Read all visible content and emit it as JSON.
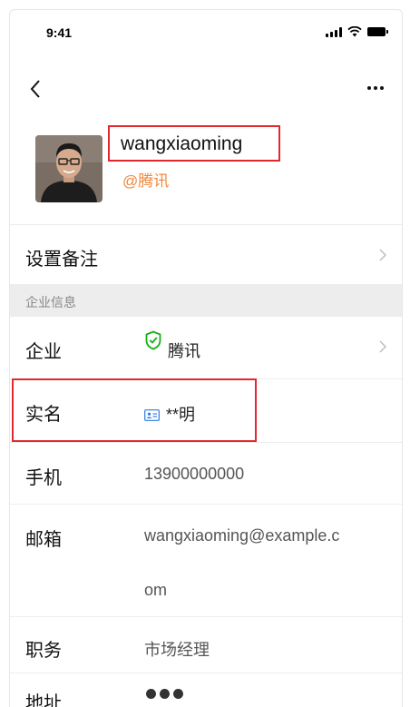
{
  "status_bar": {
    "time": "9:41",
    "icons": [
      "signal-icon",
      "wifi-icon",
      "battery-icon"
    ]
  },
  "nav": {
    "back_icon": "chevron-left-icon",
    "more_icon": "more-horizontal-icon"
  },
  "profile": {
    "name": "wangxiaoming",
    "org": "@腾讯"
  },
  "remark": {
    "label": "设置备注"
  },
  "enterprise": {
    "section_title": "企业信息",
    "company_label": "企业",
    "company_value": "腾讯",
    "realname_label": "实名",
    "realname_value": "**明",
    "phone_label": "手机",
    "phone_value": "13900000000",
    "email_label": "邮箱",
    "email_line1": "wangxiaoming@example.c",
    "email_line2": "om",
    "title_label": "职务",
    "title_value": "市场经理",
    "address_label": "地址"
  },
  "colors": {
    "accent_org": "#f0883a",
    "verified_green": "#1aad19",
    "idcard_blue": "#2a7ae2",
    "highlight_red": "#e0282e",
    "section_bg": "#ededed"
  }
}
